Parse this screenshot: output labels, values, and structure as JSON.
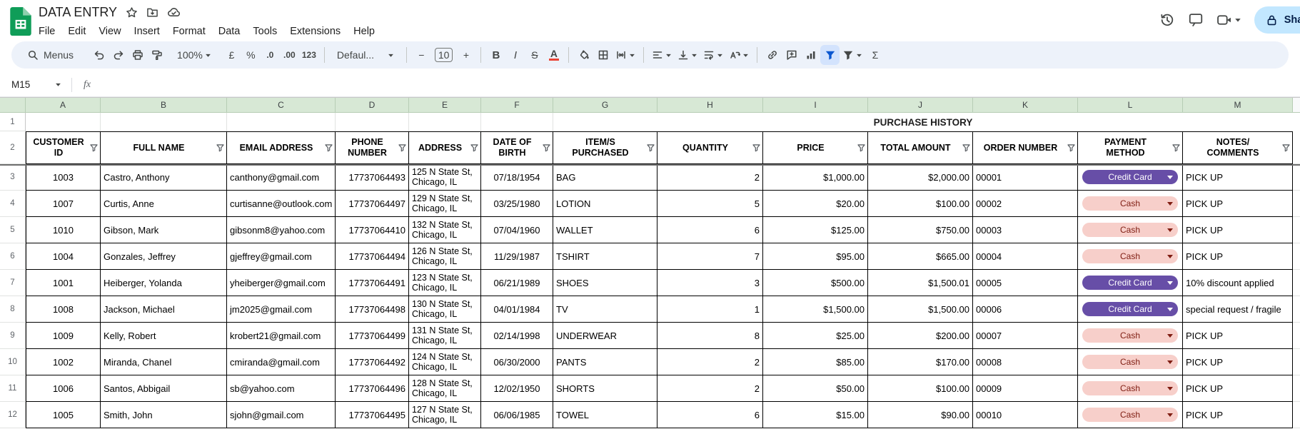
{
  "app": {
    "title": "DATA ENTRY",
    "menu": [
      "File",
      "Edit",
      "View",
      "Insert",
      "Format",
      "Data",
      "Tools",
      "Extensions",
      "Help"
    ],
    "share_label": "Share"
  },
  "toolbar": {
    "items": [
      {
        "name": "menus",
        "icon": "search",
        "label": "Menus",
        "cls": "menus"
      },
      {
        "name": "undo",
        "icon": "undo"
      },
      {
        "name": "redo",
        "icon": "redo"
      },
      {
        "name": "print",
        "icon": "print"
      },
      {
        "name": "paint-format",
        "icon": "paint"
      },
      {
        "name": "zoom",
        "label": "100%",
        "caret": true,
        "cls": "zoom"
      },
      {
        "name": "format-currency",
        "label": "£"
      },
      {
        "name": "format-percent",
        "label": "%"
      },
      {
        "name": "decrease-decimal",
        "label": ".0",
        "cls": "small"
      },
      {
        "name": "increase-decimal",
        "label": ".00",
        "cls": "small"
      },
      {
        "name": "more-formats",
        "label": "123",
        "cls": "small"
      },
      {
        "sep": true
      },
      {
        "name": "font-family",
        "label": "Defaul...",
        "caret": true,
        "cls": "font"
      },
      {
        "sep": true
      },
      {
        "name": "font-size-decrease",
        "label": "−"
      },
      {
        "name": "font-size",
        "label": "10",
        "cls": "sizebox"
      },
      {
        "name": "font-size-increase",
        "label": "+"
      },
      {
        "sep": true
      },
      {
        "name": "bold",
        "label": "B",
        "cls": "bold"
      },
      {
        "name": "italic",
        "label": "I",
        "cls": "italic"
      },
      {
        "name": "strikethrough",
        "label": "S",
        "cls": "strike"
      },
      {
        "name": "text-color",
        "label": "A",
        "cls": "textcolor"
      },
      {
        "sep": true
      },
      {
        "name": "fill-color",
        "icon": "fill"
      },
      {
        "name": "borders",
        "icon": "borders"
      },
      {
        "name": "merge-cells",
        "icon": "merge",
        "caret": true
      },
      {
        "sep": true
      },
      {
        "name": "horizontal-align",
        "icon": "align-left",
        "caret": true
      },
      {
        "name": "vertical-align",
        "icon": "valign",
        "caret": true
      },
      {
        "name": "text-wrap",
        "icon": "wrap",
        "caret": true
      },
      {
        "name": "text-rotation",
        "icon": "rotate",
        "caret": true
      },
      {
        "sep": true
      },
      {
        "name": "insert-link",
        "icon": "link"
      },
      {
        "name": "insert-comment",
        "icon": "comment"
      },
      {
        "name": "insert-chart",
        "icon": "chart"
      },
      {
        "name": "create-filter",
        "icon": "filter",
        "cls": "active"
      },
      {
        "name": "filter-views",
        "icon": "filter",
        "caret": true
      },
      {
        "name": "functions",
        "label": "Σ"
      }
    ]
  },
  "formula_bar": {
    "cell_ref": "M15",
    "fx": "fx"
  },
  "sheet": {
    "banner": "PURCHASE HISTORY",
    "column_letters": [
      "A",
      "B",
      "C",
      "D",
      "E",
      "F",
      "G",
      "H",
      "I",
      "J",
      "K",
      "L",
      "M"
    ],
    "gutter_rows": [
      "1",
      "2"
    ],
    "headers": [
      {
        "key": "customer-id",
        "label": "CUSTOMER\nID"
      },
      {
        "key": "full-name",
        "label": "FULL NAME"
      },
      {
        "key": "email-address",
        "label": "EMAIL ADDRESS"
      },
      {
        "key": "phone-number",
        "label": "PHONE\nNUMBER"
      },
      {
        "key": "address",
        "label": "ADDRESS"
      },
      {
        "key": "date-of-birth",
        "label": "DATE OF\nBIRTH"
      },
      {
        "key": "items-purchased",
        "label": "ITEM/S\nPURCHASED"
      },
      {
        "key": "quantity",
        "label": "QUANTITY"
      },
      {
        "key": "price",
        "label": "PRICE"
      },
      {
        "key": "total-amount",
        "label": "TOTAL AMOUNT"
      },
      {
        "key": "order-number",
        "label": "ORDER NUMBER"
      },
      {
        "key": "payment-method",
        "label": "PAYMENT\nMETHOD"
      },
      {
        "key": "notes-comments",
        "label": "NOTES/\nCOMMENTS"
      }
    ],
    "rows": [
      {
        "row": "3",
        "id": "1003",
        "name": "Castro, Anthony",
        "email": "canthony@gmail.com",
        "phone": "17737064493",
        "address1": "125 N State St,",
        "address2": "Chicago, IL",
        "dob": "07/18/1954",
        "item": "BAG",
        "qty": "2",
        "price": "$1,000.00",
        "total": "$2,000.00",
        "order": "00001",
        "payment": "Credit Card",
        "pay": "credit",
        "notes": "PICK UP"
      },
      {
        "row": "4",
        "id": "1007",
        "name": "Curtis, Anne",
        "email": "curtisanne@outlook.com",
        "phone": "17737064497",
        "address1": "129 N State St,",
        "address2": "Chicago, IL",
        "dob": "03/25/1980",
        "item": "LOTION",
        "qty": "5",
        "price": "$20.00",
        "total": "$100.00",
        "order": "00002",
        "payment": "Cash",
        "pay": "cash",
        "notes": "PICK UP"
      },
      {
        "row": "5",
        "id": "1010",
        "name": "Gibson, Mark",
        "email": "gibsonm8@yahoo.com",
        "phone": "17737064410",
        "address1": "132 N State St,",
        "address2": "Chicago, IL",
        "dob": "07/04/1960",
        "item": "WALLET",
        "qty": "6",
        "price": "$125.00",
        "total": "$750.00",
        "order": "00003",
        "payment": "Cash",
        "pay": "cash",
        "notes": "PICK UP"
      },
      {
        "row": "6",
        "id": "1004",
        "name": "Gonzales, Jeffrey",
        "email": "gjeffrey@gmail.com",
        "phone": "17737064494",
        "address1": "126 N State St,",
        "address2": "Chicago, IL",
        "dob": "11/29/1987",
        "item": "TSHIRT",
        "qty": "7",
        "price": "$95.00",
        "total": "$665.00",
        "order": "00004",
        "payment": "Cash",
        "pay": "cash",
        "notes": "PICK UP"
      },
      {
        "row": "7",
        "id": "1001",
        "name": "Heiberger, Yolanda",
        "email": "yheiberger@gmail.com",
        "phone": "17737064491",
        "address1": "123 N State St,",
        "address2": "Chicago, IL",
        "dob": "06/21/1989",
        "item": "SHOES",
        "qty": "3",
        "price": "$500.00",
        "total": "$1,500.01",
        "order": "00005",
        "payment": "Credit Card",
        "pay": "credit",
        "notes": "10% discount applied"
      },
      {
        "row": "8",
        "id": "1008",
        "name": "Jackson, Michael",
        "email": "jm2025@gmail.com",
        "phone": "17737064498",
        "address1": "130 N State St,",
        "address2": "Chicago, IL",
        "dob": "04/01/1984",
        "item": "TV",
        "qty": "1",
        "price": "$1,500.00",
        "total": "$1,500.00",
        "order": "00006",
        "payment": "Credit Card",
        "pay": "credit",
        "notes": "special request / fragile"
      },
      {
        "row": "9",
        "id": "1009",
        "name": "Kelly, Robert",
        "email": "krobert21@gmail.com",
        "phone": "17737064499",
        "address1": "131 N State St,",
        "address2": "Chicago, IL",
        "dob": "02/14/1998",
        "item": "UNDERWEAR",
        "qty": "8",
        "price": "$25.00",
        "total": "$200.00",
        "order": "00007",
        "payment": "Cash",
        "pay": "cash",
        "notes": "PICK UP"
      },
      {
        "row": "10",
        "id": "1002",
        "name": "Miranda, Chanel",
        "email": "cmiranda@gmail.com",
        "phone": "17737064492",
        "address1": "124 N State St,",
        "address2": "Chicago, IL",
        "dob": "06/30/2000",
        "item": "PANTS",
        "qty": "2",
        "price": "$85.00",
        "total": "$170.00",
        "order": "00008",
        "payment": "Cash",
        "pay": "cash",
        "notes": "PICK UP"
      },
      {
        "row": "11",
        "id": "1006",
        "name": "Santos, Abbigail",
        "email": "sb@yahoo.com",
        "phone": "17737064496",
        "address1": "128 N State St,",
        "address2": "Chicago, IL",
        "dob": "12/02/1950",
        "item": "SHORTS",
        "qty": "2",
        "price": "$50.00",
        "total": "$100.00",
        "order": "00009",
        "payment": "Cash",
        "pay": "cash",
        "notes": "PICK UP"
      },
      {
        "row": "12",
        "id": "1005",
        "name": "Smith, John",
        "email": "sjohn@gmail.com",
        "phone": "17737064495",
        "address1": "127 N State St,",
        "address2": "Chicago, IL",
        "dob": "06/06/1985",
        "item": "TOWEL",
        "qty": "6",
        "price": "$15.00",
        "total": "$90.00",
        "order": "00010",
        "payment": "Cash",
        "pay": "cash",
        "notes": "PICK UP"
      }
    ]
  },
  "colors": {
    "logo_green": "#0f9d58",
    "header_band": "#d7e8d5",
    "share_bg": "#c2e7ff",
    "share_text": "#041e49",
    "active_bg": "#d3e3fd",
    "active_fg": "#0b57d0",
    "credit_bg": "#674ea7",
    "credit_text": "#ffffff",
    "cash_bg": "#f7cfca",
    "cash_text": "#7f1d12"
  }
}
